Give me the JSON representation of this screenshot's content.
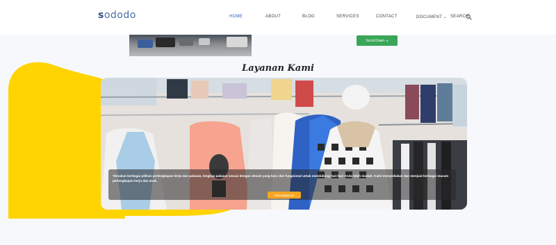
{
  "brand": {
    "logo_mark": "s",
    "logo_text": "ododo"
  },
  "nav": {
    "items": [
      {
        "label": "HOME",
        "active": true
      },
      {
        "label": "ABOUT",
        "active": false
      },
      {
        "label": "BLOG",
        "active": false
      },
      {
        "label": "SERVICES",
        "active": false
      },
      {
        "label": "CONTACT",
        "active": false
      },
      {
        "label": "DOCUMENT ⌄",
        "active": false
      },
      {
        "label": "SEARCH",
        "active": false
      }
    ],
    "search_icon": "search-icon"
  },
  "previous_section": {
    "button_label": "Scroll Down ⬎",
    "button_color": "#3aa657"
  },
  "services": {
    "title": "Layanan Kami",
    "caption": "Temukan berbagai pilihan perlengkapan kerja dan pakaian, lengkap pakaian sesuai dengan desain yang baru dan fungsional untuk mendukung hari-hari Anda lebih mudah. Kami menyediakan dan menjual berbagai macam perlengkapan kerja dan anak.",
    "button_label": "Selengkapnya",
    "accent_color": "#f5a623",
    "blob_color": "#ffd400"
  }
}
